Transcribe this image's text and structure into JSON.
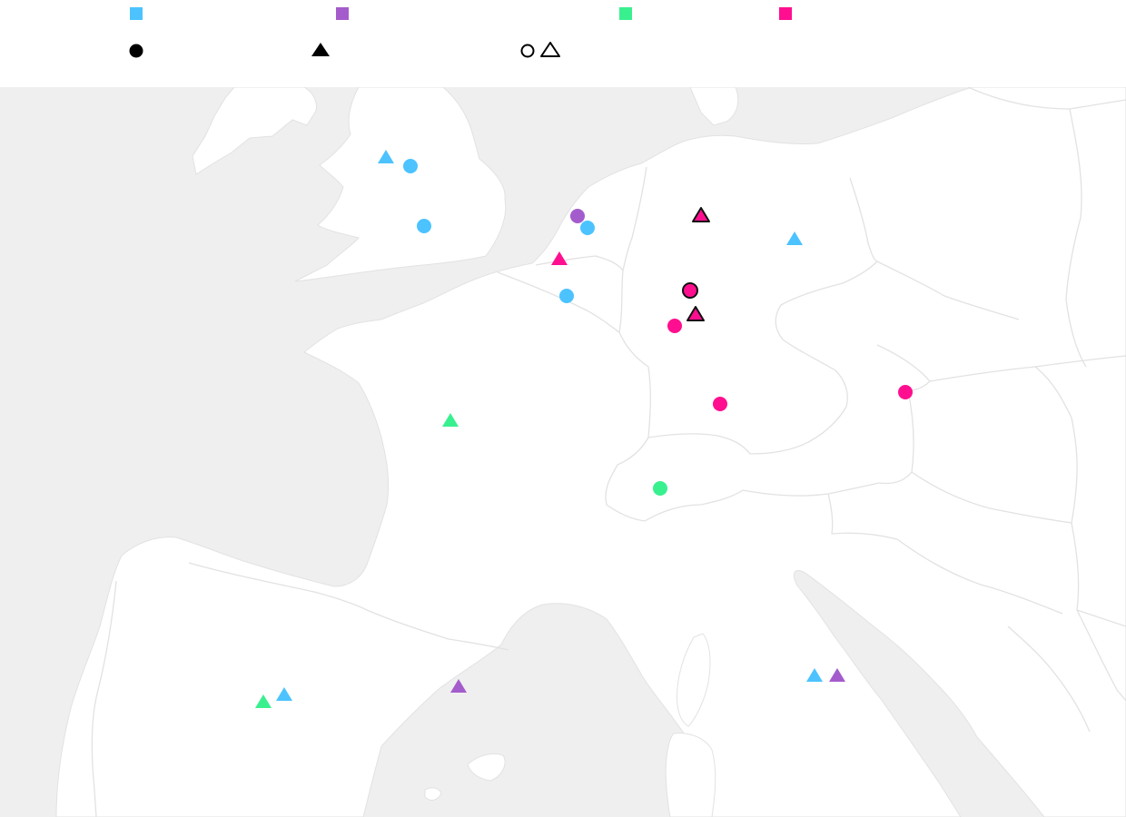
{
  "colors": {
    "sea": "#efefef",
    "land": "#ffffff",
    "border": "#e2e2e2",
    "outline": "#111111"
  },
  "legend": {
    "categories": [
      {
        "color": "#4cc3ff",
        "icon": "square-swatch"
      },
      {
        "color": "#a45ccc",
        "icon": "square-swatch"
      },
      {
        "color": "#39f08f",
        "icon": "square-swatch"
      },
      {
        "color": "#ff0f8f",
        "icon": "square-swatch"
      }
    ],
    "shapes": [
      {
        "icon": "filled-circle"
      },
      {
        "icon": "filled-triangle"
      },
      {
        "icon": "hollow-circle"
      },
      {
        "icon": "hollow-triangle"
      }
    ]
  },
  "markers": [
    {
      "shape": "triangle",
      "color": "#4cc3ff",
      "outlined": false
    },
    {
      "shape": "circle",
      "color": "#4cc3ff",
      "outlined": false
    },
    {
      "shape": "circle",
      "color": "#4cc3ff",
      "outlined": false
    },
    {
      "shape": "circle",
      "color": "#a45ccc",
      "outlined": false
    },
    {
      "shape": "circle",
      "color": "#4cc3ff",
      "outlined": false
    },
    {
      "shape": "triangle",
      "color": "#ff0f8f",
      "outlined": false
    },
    {
      "shape": "circle",
      "color": "#4cc3ff",
      "outlined": false
    },
    {
      "shape": "triangle",
      "color": "#ff0f8f",
      "outlined": true
    },
    {
      "shape": "triangle",
      "color": "#4cc3ff",
      "outlined": false
    },
    {
      "shape": "circle",
      "color": "#ff0f8f",
      "outlined": true
    },
    {
      "shape": "triangle",
      "color": "#ff0f8f",
      "outlined": true
    },
    {
      "shape": "circle",
      "color": "#ff0f8f",
      "outlined": false
    },
    {
      "shape": "circle",
      "color": "#ff0f8f",
      "outlined": false
    },
    {
      "shape": "circle",
      "color": "#ff0f8f",
      "outlined": false
    },
    {
      "shape": "triangle",
      "color": "#39f08f",
      "outlined": false
    },
    {
      "shape": "circle",
      "color": "#39f08f",
      "outlined": false
    },
    {
      "shape": "triangle",
      "color": "#39f08f",
      "outlined": false
    },
    {
      "shape": "triangle",
      "color": "#4cc3ff",
      "outlined": false
    },
    {
      "shape": "triangle",
      "color": "#a45ccc",
      "outlined": false
    },
    {
      "shape": "triangle",
      "color": "#4cc3ff",
      "outlined": false
    },
    {
      "shape": "triangle",
      "color": "#a45ccc",
      "outlined": false
    }
  ]
}
